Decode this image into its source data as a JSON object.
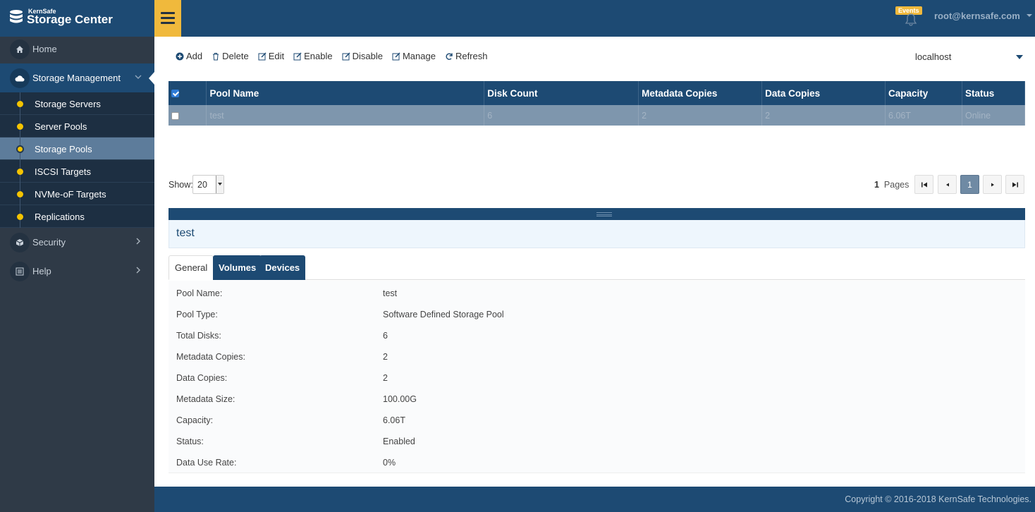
{
  "app": {
    "brand": "KernSafe",
    "title": "Storage Center"
  },
  "header": {
    "events_label": "Events",
    "user": "root@kernsafe.com"
  },
  "sidebar": {
    "items": [
      {
        "label": "Home",
        "icon": "home-icon"
      },
      {
        "label": "Storage Management",
        "icon": "cloud-icon"
      },
      {
        "label": "Security",
        "icon": "cube-icon"
      },
      {
        "label": "Help",
        "icon": "list-icon"
      }
    ],
    "sub_items": [
      {
        "label": "Storage Servers"
      },
      {
        "label": "Server Pools"
      },
      {
        "label": "Storage Pools"
      },
      {
        "label": "ISCSI Targets"
      },
      {
        "label": "NVMe-oF Targets"
      },
      {
        "label": "Replications"
      }
    ]
  },
  "toolbar": {
    "add": "Add",
    "delete": "Delete",
    "edit": "Edit",
    "enable": "Enable",
    "disable": "Disable",
    "manage": "Manage",
    "refresh": "Refresh",
    "host": "localhost"
  },
  "table": {
    "columns": [
      "Pool Name",
      "Disk Count",
      "Metadata Copies",
      "Data Copies",
      "Capacity",
      "Status"
    ],
    "rows": [
      {
        "pool_name": "test",
        "disk_count": "6",
        "metadata_copies": "2",
        "data_copies": "2",
        "capacity": "6.06T",
        "status": "Online"
      }
    ]
  },
  "pagination": {
    "show_label": "Show:",
    "page_size": "20",
    "page_count": "1",
    "pages_label": "Pages",
    "current_page": "1"
  },
  "detail": {
    "title": "test",
    "tabs": [
      "General",
      "Volumes",
      "Devices"
    ],
    "properties": [
      {
        "key": "Pool Name:",
        "value": "test"
      },
      {
        "key": "Pool Type:",
        "value": "Software Defined Storage Pool"
      },
      {
        "key": "Total Disks:",
        "value": "6"
      },
      {
        "key": "Metadata Copies:",
        "value": "2"
      },
      {
        "key": "Data Copies:",
        "value": "2"
      },
      {
        "key": "Metadata Size:",
        "value": "100.00G"
      },
      {
        "key": "Capacity:",
        "value": "6.06T"
      },
      {
        "key": "Status:",
        "value": "Enabled"
      },
      {
        "key": "Data Use Rate:",
        "value": "0%"
      }
    ]
  },
  "footer": {
    "copyright": "Copyright © 2016-2018 KernSafe Technologies."
  }
}
